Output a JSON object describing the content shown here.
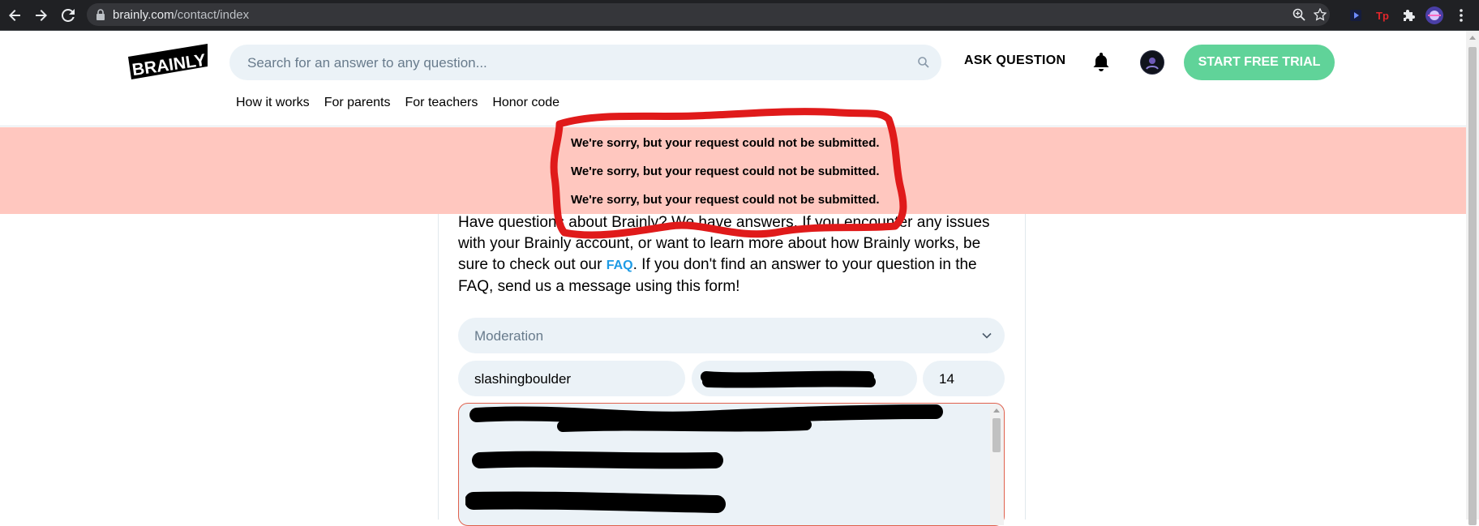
{
  "browser": {
    "url_host": "brainly.com",
    "url_path": "/contact/index",
    "icons": [
      "back-arrow-icon",
      "forward-arrow-icon",
      "reload-icon",
      "lock-icon",
      "zoom-icon",
      "star-icon",
      "extension-puzzle-icon",
      "menu-icon"
    ]
  },
  "header": {
    "logo_text": "BRAINLY",
    "search_placeholder": "Search for an answer to any question...",
    "ask_label": "ASK QUESTION",
    "trial_label": "START FREE TRIAL",
    "subnav": [
      "How it works",
      "For parents",
      "For teachers",
      "Honor code"
    ]
  },
  "banner": {
    "messages": [
      "We're sorry, but your request could not be submitted.",
      "We're sorry, but your request could not be submitted.",
      "We're sorry, but your request could not be submitted."
    ],
    "background": "#ffc7bf",
    "annotation_color": "#e01a1a"
  },
  "form": {
    "intro_before": "Have questions about Brainly? We have answers. If you encounter any issues with your Brainly account, or want to learn more about how Brainly works, be sure to check out our ",
    "faq_link": "FAQ",
    "intro_after": ". If you don't find an answer to your question in the FAQ, send us a message using this form!",
    "topic_value": "Moderation",
    "username_value": "slashingboulder",
    "age_value": "14"
  },
  "colors": {
    "accent_green": "#60d399",
    "field_bg": "#ebf2f7",
    "link_blue": "#1e9be5",
    "error_border": "#e0604c"
  }
}
